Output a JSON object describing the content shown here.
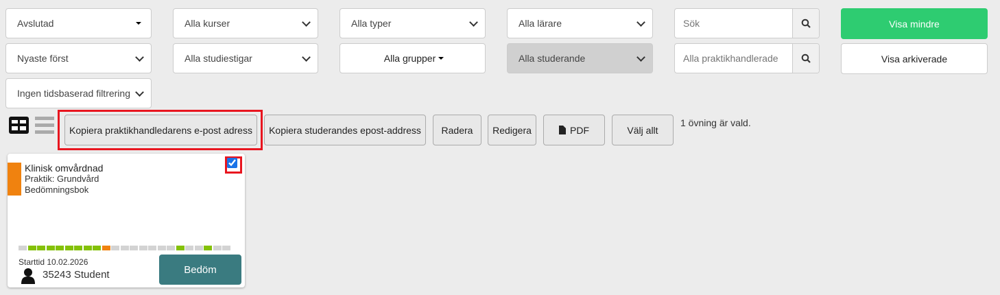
{
  "filters": {
    "status": "Avslutad",
    "courses": "Alla kurser",
    "types": "Alla typer",
    "teachers": "Alla lärare",
    "search_placeholder": "Sök",
    "show_less": "Visa mindre",
    "sort": "Nyaste först",
    "paths": "Alla studiestigar",
    "groups": "Alla grupper",
    "students": "Alla studerande",
    "supervisor_placeholder": "Alla praktikhandlerade",
    "show_archived": "Visa arkiverade",
    "time": "Ingen tidsbaserad filtrering"
  },
  "actions": {
    "copy_supervisor": "Kopiera praktikhandledarens e-post adress",
    "copy_student": "Kopiera studerandes epost-address",
    "delete": "Radera",
    "edit": "Redigera",
    "pdf": "PDF",
    "select_all": "Välj allt",
    "selected_status": "1 övning är vald."
  },
  "card": {
    "title": "Klinisk omvårdnad",
    "subtitle": "Praktik: Grundvård",
    "type": "Bedömningsbok",
    "start": "Starttid 10.02.2026",
    "student": "35243 Student",
    "assess": "Bedöm",
    "checked": true,
    "accent": "#f0820f",
    "progress": [
      "gray",
      "green",
      "green",
      "green",
      "green",
      "green",
      "green",
      "green",
      "green",
      "orange",
      "gray",
      "gray",
      "gray",
      "gray",
      "gray",
      "gray",
      "gray",
      "green",
      "gray",
      "gray",
      "green",
      "gray",
      "gray"
    ]
  },
  "colors": {
    "green": "#84c108",
    "orange": "#f0820f",
    "gray": "#d3d3d3",
    "primary": "#2ecc71",
    "teal": "#3a7b80"
  }
}
